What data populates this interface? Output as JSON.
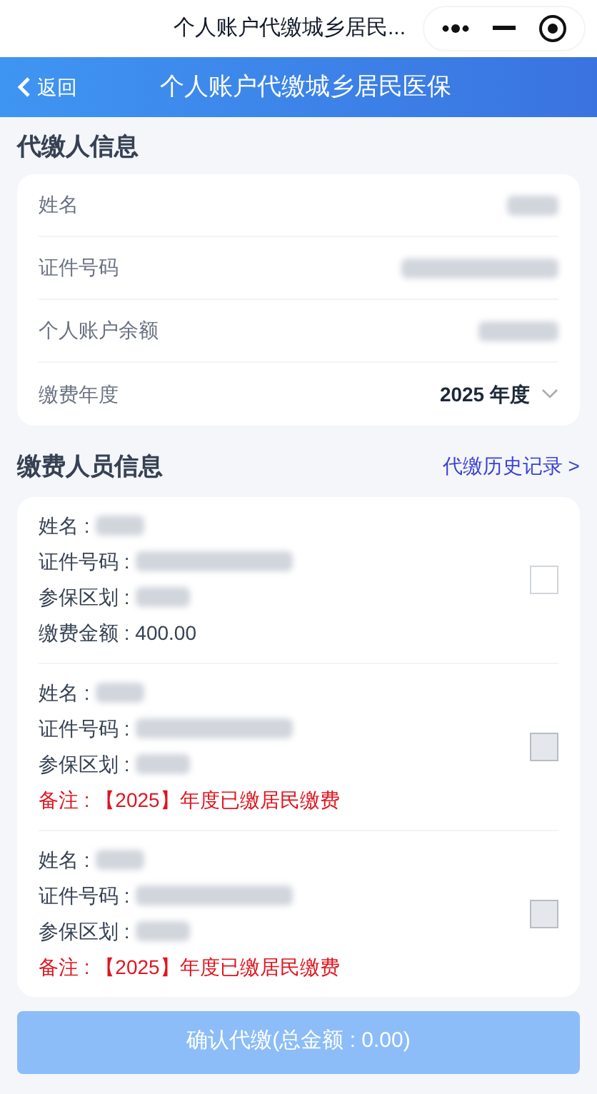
{
  "capsule_title": "个人账户代缴城乡居民...",
  "header": {
    "back": "返回",
    "title": "个人账户代缴城乡居民医保"
  },
  "payer": {
    "heading": "代缴人信息",
    "fields": [
      {
        "label": "姓名",
        "kind": "redacted"
      },
      {
        "label": "证件号码",
        "kind": "redacted"
      },
      {
        "label": "个人账户余额",
        "kind": "redacted"
      },
      {
        "label": "缴费年度",
        "kind": "select",
        "value": "2025 年度"
      }
    ]
  },
  "members": {
    "heading": "缴费人员信息",
    "history_link": "代缴历史记录 >",
    "people": [
      {
        "name_label": "姓名 :",
        "id_label": "证件号码 :",
        "area_label": "参保区划 :",
        "amount": "缴费金额 : 400.00",
        "disabled": false,
        "checked": false
      },
      {
        "name_label": "姓名 :",
        "id_label": "证件号码 :",
        "area_label": "参保区划 :",
        "remark": "备注 : 【2025】年度已缴居民缴费",
        "disabled": true,
        "checked": false
      },
      {
        "name_label": "姓名 :",
        "id_label": "证件号码 :",
        "area_label": "参保区划 :",
        "remark": "备注 : 【2025】年度已缴居民缴费",
        "disabled": true,
        "checked": false
      }
    ]
  },
  "confirm_button": {
    "label": "确认代缴(总金额 : 0.00)",
    "disabled": true
  }
}
